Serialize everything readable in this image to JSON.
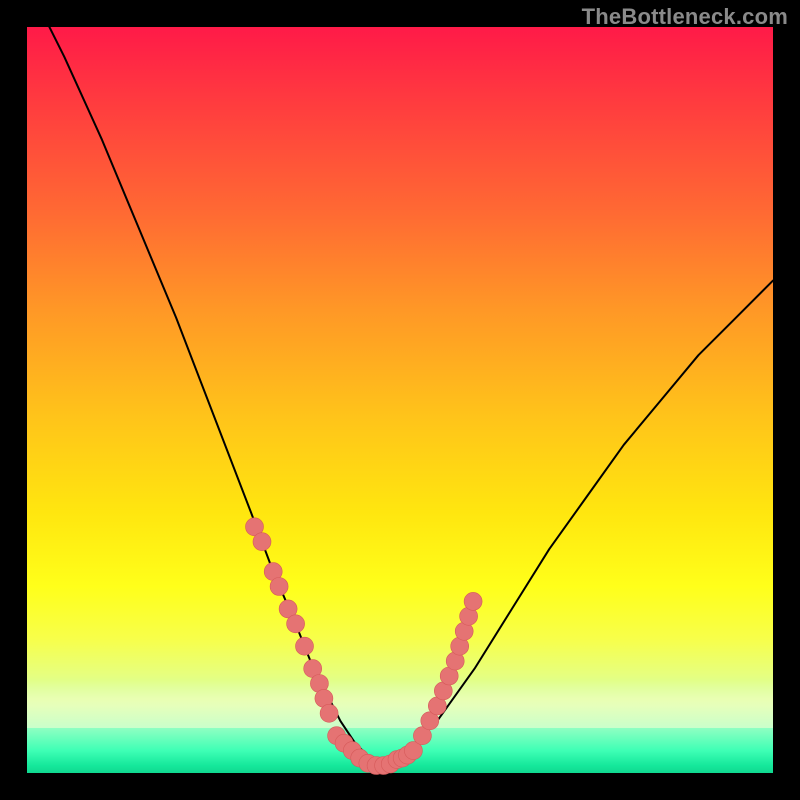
{
  "watermark": "TheBottleneck.com",
  "colors": {
    "curve_stroke": "#000000",
    "marker_fill": "#e57373",
    "marker_stroke": "#d65a5a",
    "background": "#000000"
  },
  "chart_data": {
    "type": "line",
    "title": "",
    "xlabel": "",
    "ylabel": "",
    "xlim": [
      0,
      100
    ],
    "ylim": [
      0,
      100
    ],
    "x": [
      0,
      5,
      10,
      15,
      20,
      25,
      30,
      33,
      36,
      38,
      40,
      42,
      44,
      46,
      48,
      50,
      55,
      60,
      65,
      70,
      75,
      80,
      85,
      90,
      95,
      100
    ],
    "values": [
      106,
      96,
      85,
      73,
      61,
      48,
      35,
      27,
      20,
      15,
      11,
      7,
      4,
      2,
      1,
      2,
      7,
      14,
      22,
      30,
      37,
      44,
      50,
      56,
      61,
      66
    ],
    "markers": {
      "left_cluster_x": [
        30.5,
        31.5,
        33.0,
        33.8,
        35.0,
        36.0,
        37.2,
        38.3,
        39.2,
        39.8,
        40.5
      ],
      "left_cluster_y": [
        33,
        31,
        27,
        25,
        22,
        20,
        17,
        14,
        12,
        10,
        8
      ],
      "bottom_cluster_x": [
        41.5,
        42.5,
        43.6,
        44.6,
        45.7,
        46.8,
        47.8,
        48.7,
        49.6,
        50.3,
        51.0,
        51.8
      ],
      "bottom_cluster_y": [
        5,
        4,
        3,
        2,
        1.3,
        1,
        1,
        1.2,
        1.8,
        2,
        2.4,
        3
      ],
      "right_cluster_x": [
        53.0,
        54.0,
        55.0,
        55.8,
        56.6,
        57.4,
        58.0,
        58.6,
        59.2,
        59.8
      ],
      "right_cluster_y": [
        5,
        7,
        9,
        11,
        13,
        15,
        17,
        19,
        21,
        23
      ]
    }
  }
}
